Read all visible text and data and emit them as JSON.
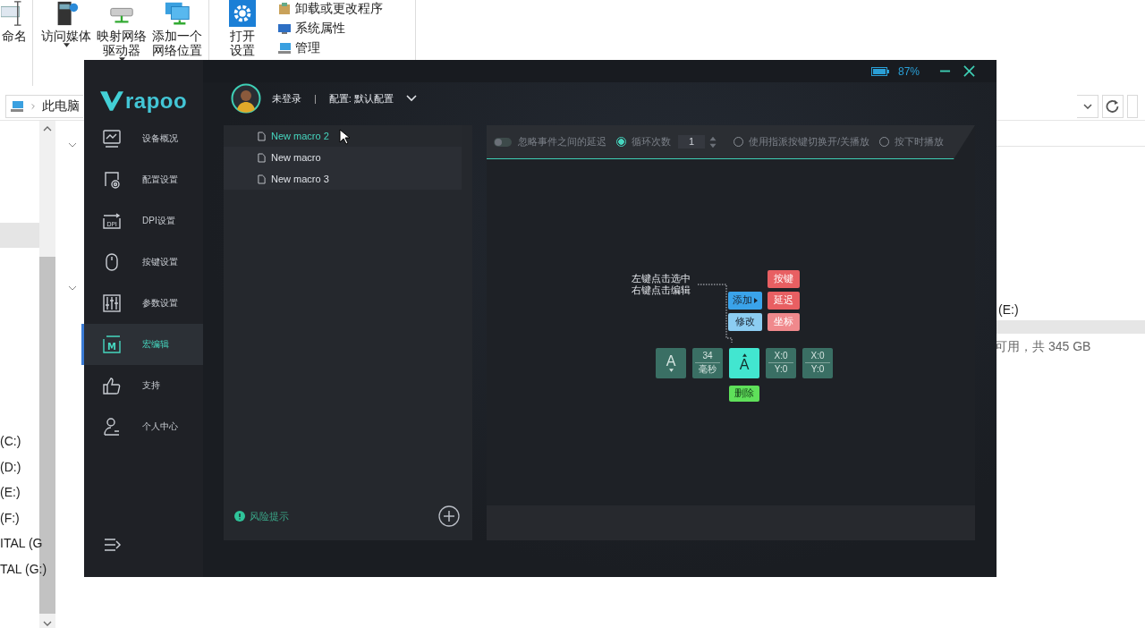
{
  "explorer": {
    "ribbon_buttons": [
      {
        "lines": [
          "命名"
        ],
        "dropdown": false
      },
      {
        "lines": [
          "访问媒体"
        ],
        "dropdown": true
      },
      {
        "lines": [
          "映射网络",
          "驱动器"
        ],
        "dropdown": true
      },
      {
        "lines": [
          "添加一个",
          "网络位置"
        ],
        "dropdown": false
      },
      {
        "lines": [
          "打开",
          "设置"
        ],
        "dropdown": false
      }
    ],
    "ribbon_links": [
      "卸载或更改程序",
      "系统属性",
      "管理"
    ],
    "address": "此电脑",
    "drives": [
      "(C:)",
      "(D:)",
      "(E:)",
      "(F:)",
      "ITAL (G",
      "TAL (G:)"
    ],
    "drive_detail": {
      "name": "(E:)",
      "free_space": "可用，共 345 GB"
    }
  },
  "app": {
    "logo": "rapoo",
    "battery": "87%",
    "user": {
      "status": "未登录",
      "separator": "|",
      "profile": "配置: 默认配置"
    },
    "nav": [
      {
        "label": "设备概况",
        "selected": false
      },
      {
        "label": "配置设置",
        "selected": false
      },
      {
        "icon_text": "DPI",
        "label": "DPI设置",
        "selected": false
      },
      {
        "label": "按键设置",
        "selected": false
      },
      {
        "label": "参数设置",
        "selected": false
      },
      {
        "icon_text": "M",
        "label": "宏编辑",
        "selected": true
      },
      {
        "label": "支持",
        "selected": false
      },
      {
        "label": "个人中心",
        "selected": false
      }
    ],
    "macros": [
      {
        "name": "New macro 2",
        "selected": true
      },
      {
        "name": "New macro",
        "selected": false
      },
      {
        "name": "New macro 3",
        "selected": false
      }
    ],
    "risk_notice": "风险提示",
    "ignore_delay": {
      "label": "忽略事件之间的延迟",
      "on": false
    },
    "modes": [
      {
        "kind": "loop",
        "label": "循环次数",
        "selected": true,
        "count": "1"
      },
      {
        "kind": "plain",
        "label": "使用指派按键切换开/关播放",
        "selected": false
      },
      {
        "kind": "plain",
        "label": "按下时播放",
        "selected": false
      }
    ],
    "guide": {
      "hint_lines": [
        "左键点击选中",
        "右键点击编辑"
      ],
      "actions": [
        {
          "kind": "add",
          "label": "添加",
          "submenu": true
        },
        {
          "kind": "edit",
          "label": "修改",
          "submenu": false
        }
      ],
      "insert_types": [
        {
          "label": "按键",
          "color": "#e85f62"
        },
        {
          "label": "延迟",
          "color": "#e85f62"
        },
        {
          "label": "坐标",
          "color": "#f0898c"
        }
      ],
      "events": [
        {
          "kind": "key_down",
          "label": "A",
          "selected": false
        },
        {
          "kind": "delay",
          "value": "34",
          "unit": "毫秒",
          "selected": false
        },
        {
          "kind": "key_up",
          "label": "A",
          "selected": true
        },
        {
          "kind": "coord",
          "x": "X:0",
          "y": "Y:0",
          "selected": false
        },
        {
          "kind": "coord",
          "x": "X:0",
          "y": "Y:0",
          "selected": false
        }
      ],
      "delete": "删除"
    }
  }
}
